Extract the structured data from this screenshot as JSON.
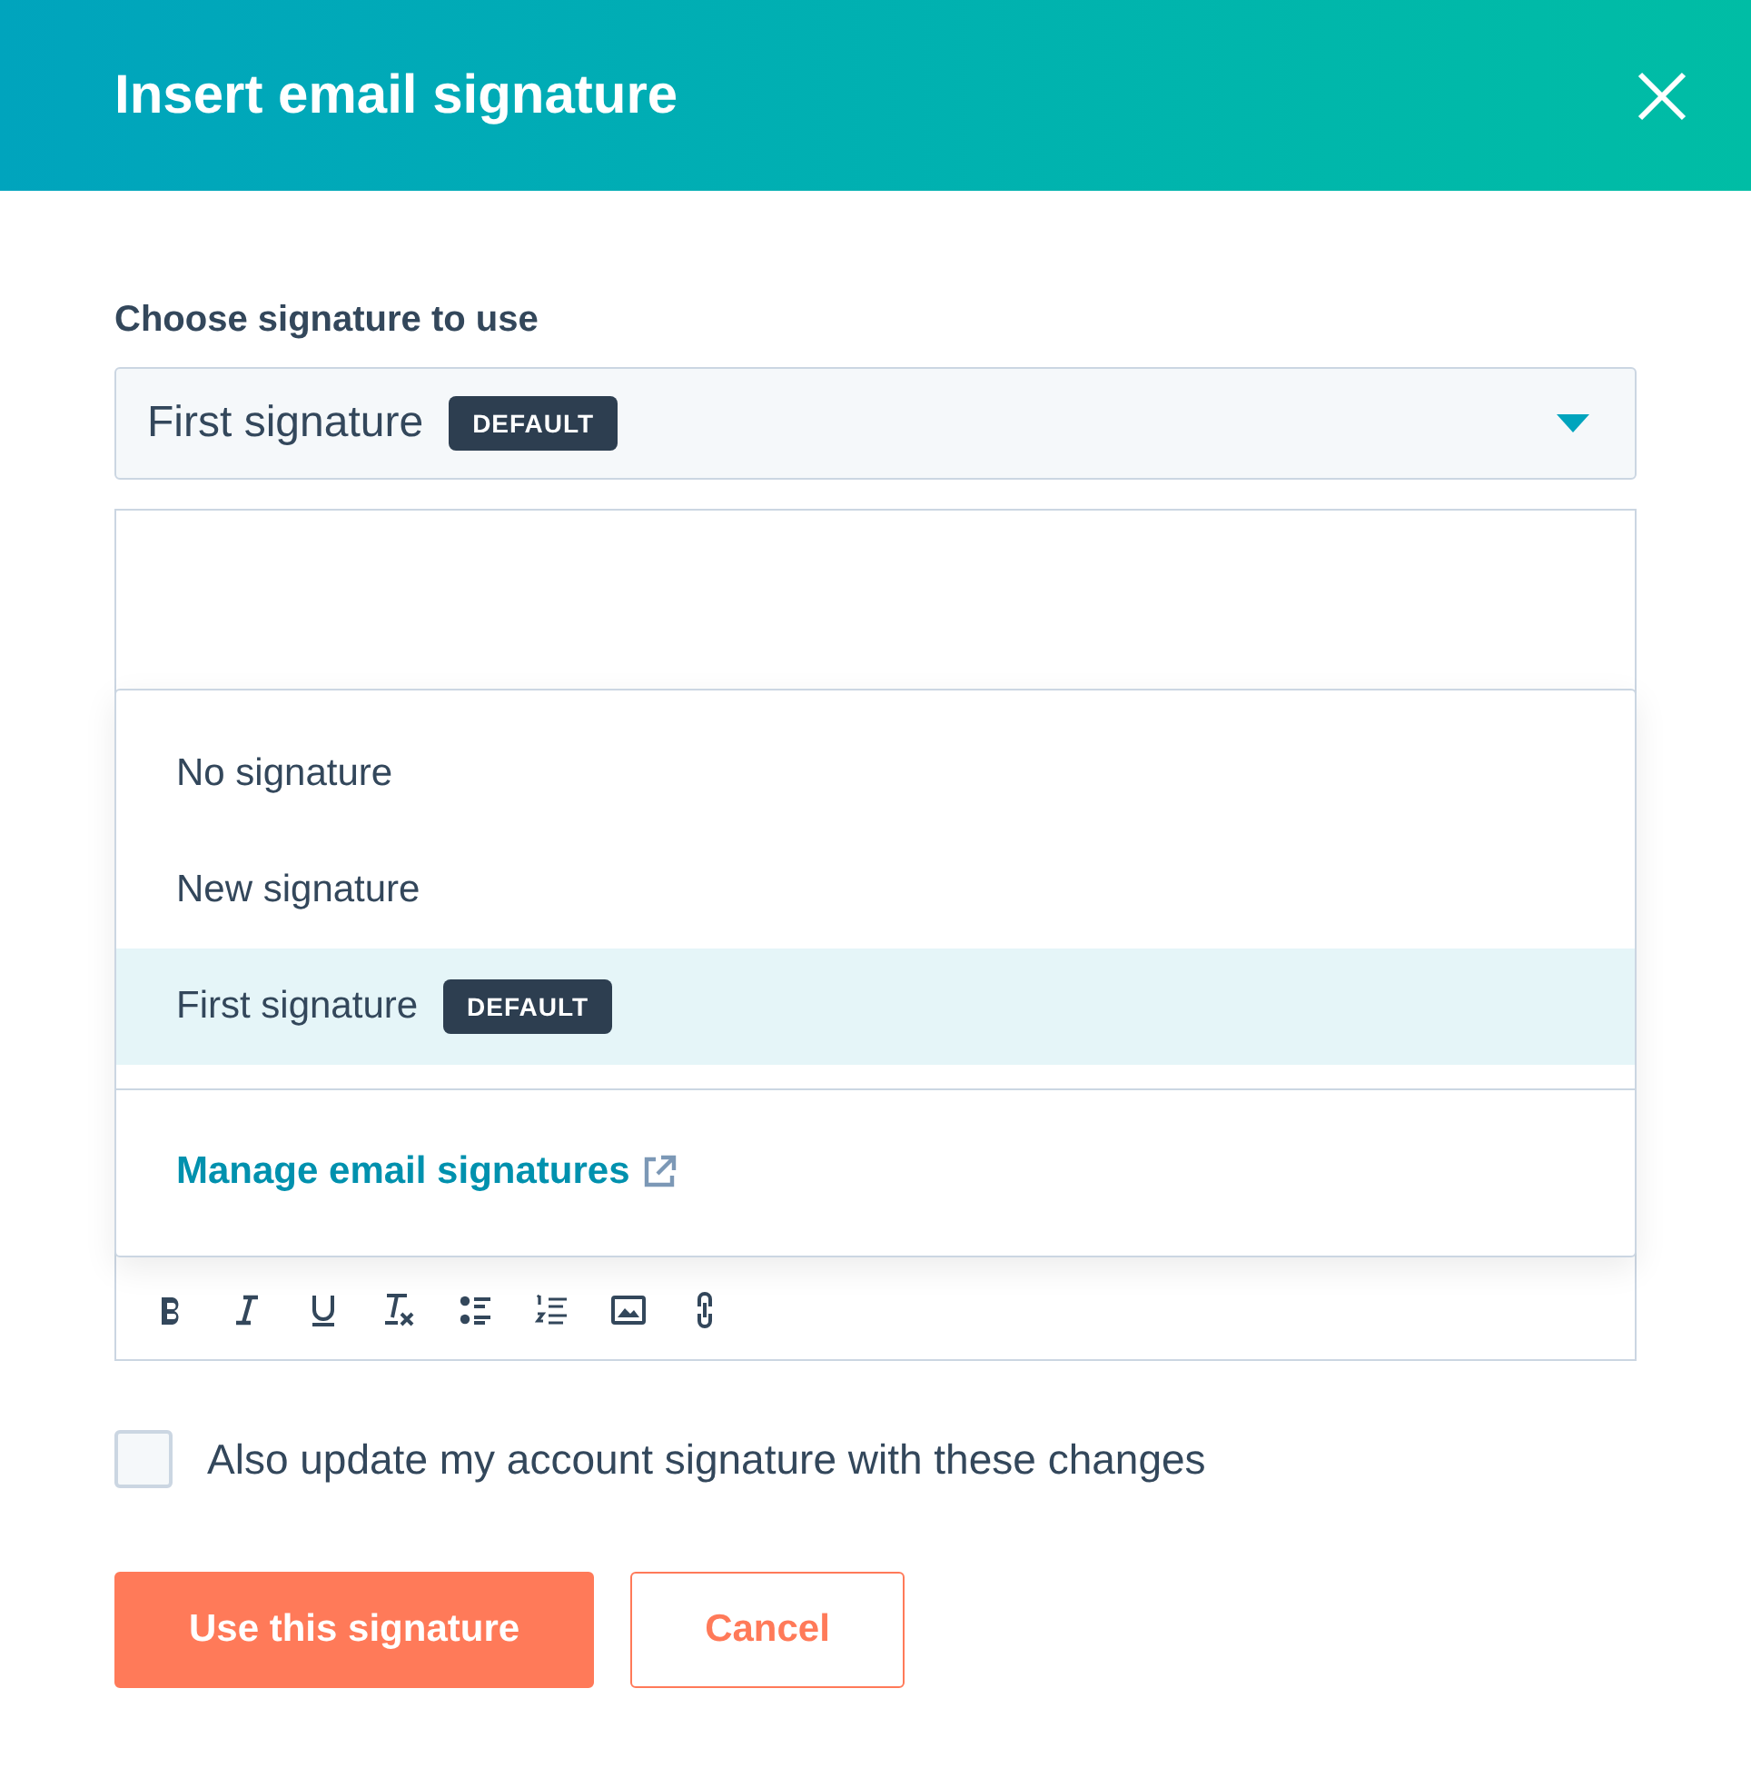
{
  "dialog": {
    "title": "Insert email signature"
  },
  "select": {
    "label": "Choose signature to use",
    "value": "First signature",
    "badge": "DEFAULT",
    "expanded": true
  },
  "options": [
    {
      "label": "No signature",
      "selected": false
    },
    {
      "label": "New signature",
      "selected": false
    },
    {
      "label": "First signature",
      "badge": "DEFAULT",
      "selected": true
    }
  ],
  "manage_link": "Manage email signatures",
  "checkbox": {
    "label": "Also update my account signature with these changes",
    "checked": false
  },
  "buttons": [
    {
      "label": "Use this signature",
      "kind": "primary"
    },
    {
      "label": "Cancel",
      "kind": "secondary"
    }
  ]
}
